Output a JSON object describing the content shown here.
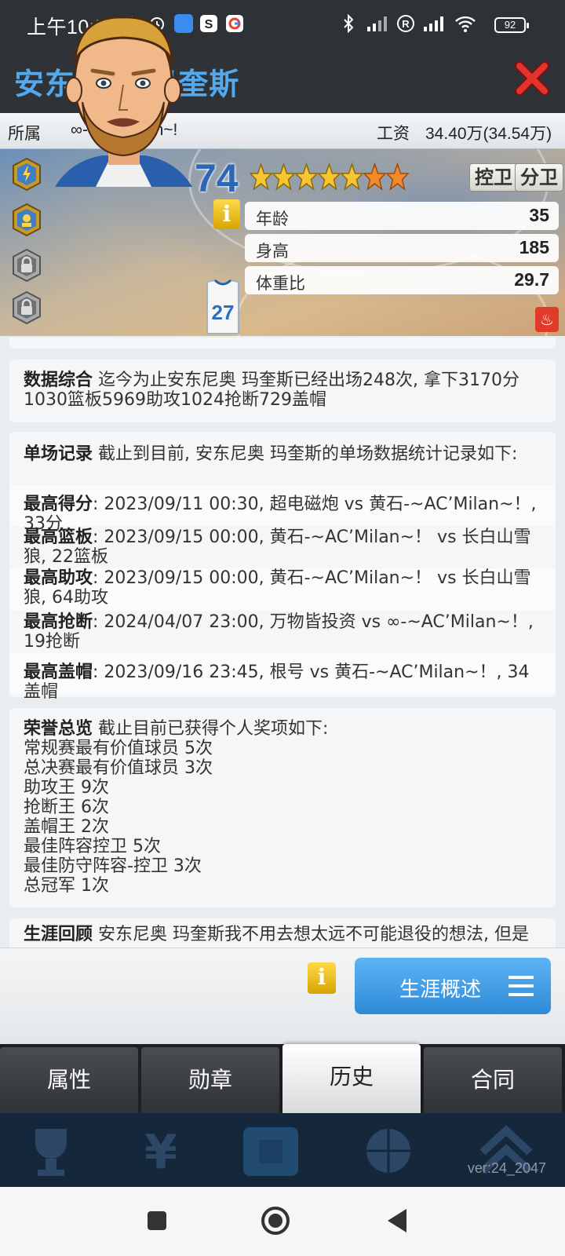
{
  "status_bar": {
    "time": "上午10:56",
    "battery": "92"
  },
  "header": {
    "title": "安东尼奥 玛奎斯"
  },
  "team_row": {
    "team_label": "所属",
    "team_value": "∞-~AC’Milan~!",
    "salary_label": "工资",
    "salary_value": "34.40万(34.54万)"
  },
  "player": {
    "overall": "74",
    "stars": 7,
    "positions": [
      "控卫",
      "分卫"
    ],
    "jersey_number": "27",
    "info_icon": "i",
    "stats": [
      {
        "label": "年龄",
        "value": "35"
      },
      {
        "label": "身高",
        "value": "185"
      },
      {
        "label": "体重比",
        "value": "29.7"
      }
    ]
  },
  "summary": {
    "heading": "数据综合",
    "text": "迄今为止安东尼奥 玛奎斯已经出场248次, 拿下3170分1030篮板5969助攻1024抢断729盖帽"
  },
  "records": {
    "heading": "单场记录",
    "intro": "截止到目前, 安东尼奥 玛奎斯的单场数据统计记录如下:",
    "items": [
      {
        "label": "最高得分",
        "text": ": 2023/09/11 00:30, 超电磁炮 vs 黄石-~AC’Milan~！, 33分"
      },
      {
        "label": "最高篮板",
        "text": ": 2023/09/15 00:00, 黄石-~AC’Milan~！ vs 长白山雪狼, 22篮板"
      },
      {
        "label": "最高助攻",
        "text": ": 2023/09/15 00:00, 黄石-~AC’Milan~！ vs 长白山雪狼, 64助攻"
      },
      {
        "label": "最高抢断",
        "text": ": 2024/04/07 23:00, 万物皆投资 vs ∞-~AC’Milan~！, 19抢断"
      },
      {
        "label": "最高盖帽",
        "text": ": 2023/09/16 23:45, 根号 vs 黄石-~AC’Milan~！, 34盖帽"
      }
    ]
  },
  "honors": {
    "heading": "荣誉总览",
    "intro": "截止目前已获得个人奖项如下:",
    "items": [
      "常规赛最有价值球员 5次",
      "总决赛最有价值球员 3次",
      "助攻王 9次",
      "抢断王 6次",
      "盖帽王 2次",
      "最佳阵容控卫 5次",
      "最佳防守阵容-控卫 3次",
      "总冠军 1次"
    ]
  },
  "career": {
    "partial_heading": "生涯回顾",
    "partial_text": "安东尼奥 玛奎斯我不用去想太远不可能退役的想法, 但是"
  },
  "action": {
    "info_icon": "i",
    "career_button": "生涯概述"
  },
  "tabs": [
    {
      "label": "属性",
      "active": false
    },
    {
      "label": "勋章",
      "active": false
    },
    {
      "label": "历史",
      "active": true
    },
    {
      "label": "合同",
      "active": false
    }
  ],
  "version": "ver:24_2047"
}
